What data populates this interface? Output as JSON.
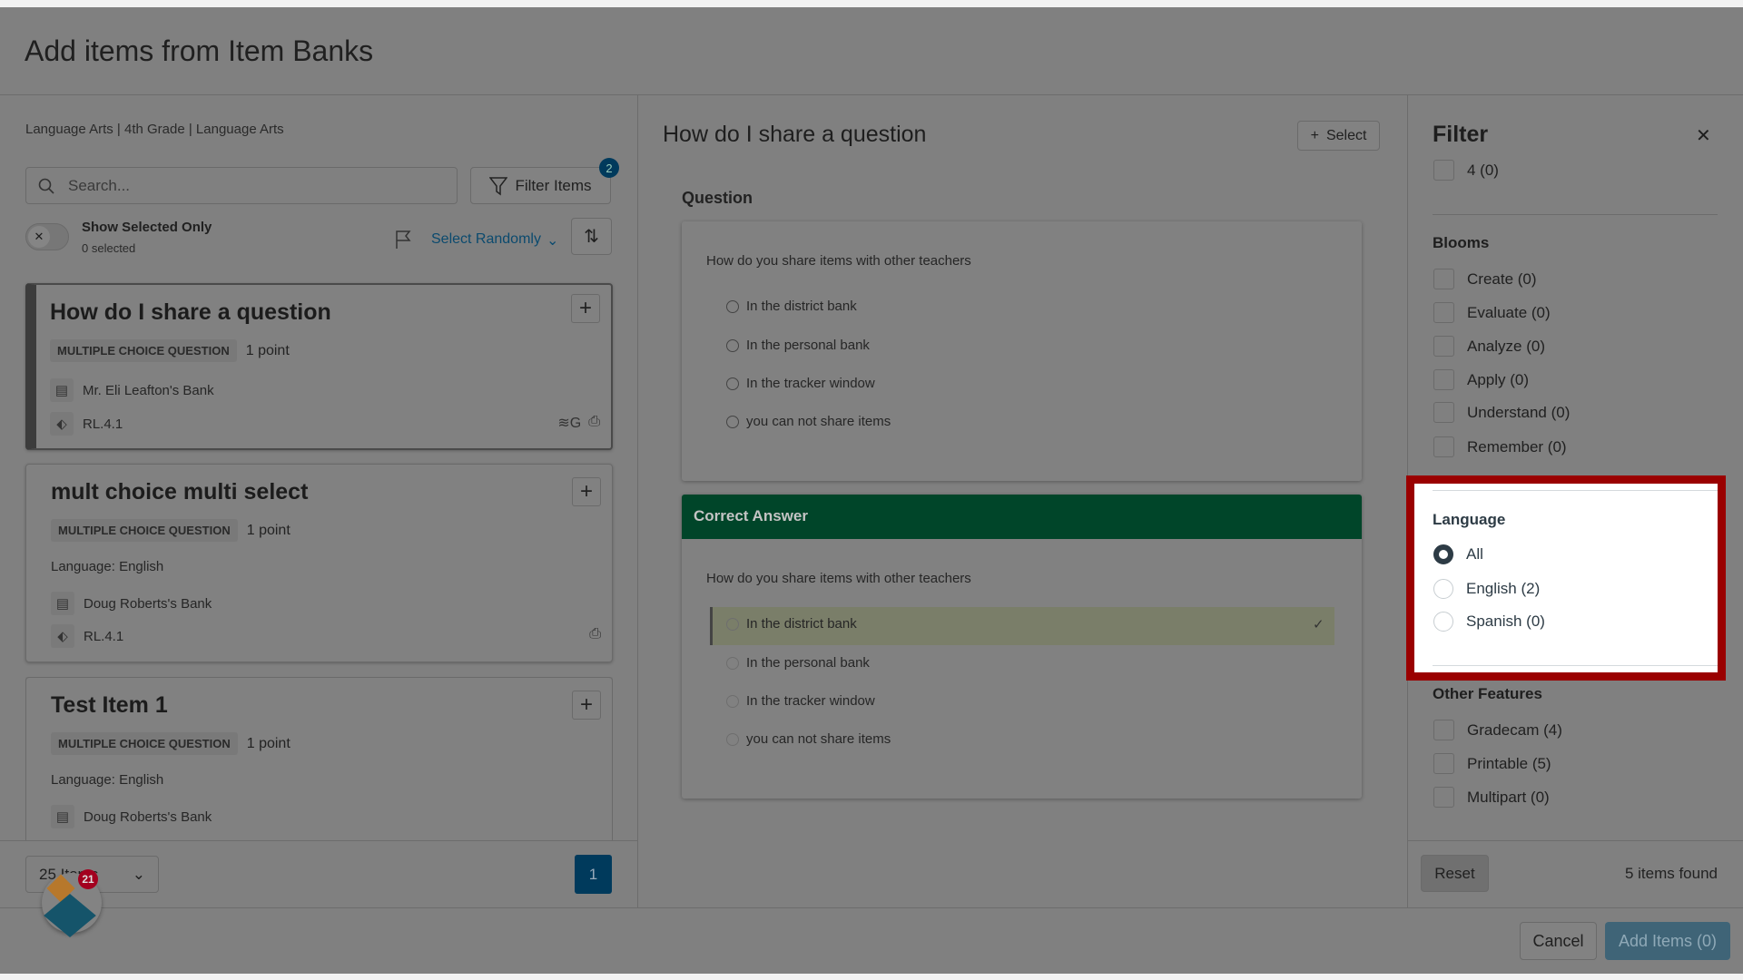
{
  "modal": {
    "title": "Add items from Item Banks"
  },
  "left": {
    "breadcrumb": "Language Arts | 4th Grade | Language Arts",
    "search_placeholder": "Search...",
    "filter_button": "Filter Items",
    "filter_badge": "2",
    "toggle_icon": "x-icon",
    "show_selected_label": "Show Selected Only",
    "selected_count": "0 selected",
    "select_randomly": "Select Randomly",
    "items": [
      {
        "title": "How do I share a question",
        "type": "MULTIPLE CHOICE QUESTION",
        "points": "1 point",
        "bank": "Mr. Eli Leafton's Bank",
        "standard": "RL.4.1",
        "selected": true
      },
      {
        "title": "mult choice multi select",
        "type": "MULTIPLE CHOICE QUESTION",
        "points": "1 point",
        "language": "Language: English",
        "bank": "Doug Roberts's Bank",
        "standard": "RL.4.1"
      },
      {
        "title": "Test Item 1",
        "type": "MULTIPLE CHOICE QUESTION",
        "points": "1 point",
        "language": "Language: English",
        "bank": "Doug Roberts's Bank"
      }
    ],
    "per_page": "25 Items",
    "page": "1",
    "app_badge": "21"
  },
  "preview": {
    "title": "How do I share a question",
    "select_button": "Select",
    "question_label": "Question",
    "question_text": "How do you share items with other teachers",
    "options": [
      "In the district bank",
      "In the personal bank",
      "In the tracker window",
      "you can not share items"
    ],
    "correct_header": "Correct Answer",
    "correct_index": 0
  },
  "filter": {
    "title": "Filter",
    "partial_item": "4 (0)",
    "blooms_title": "Blooms",
    "blooms": [
      "Create (0)",
      "Evaluate (0)",
      "Analyze (0)",
      "Apply (0)",
      "Understand (0)",
      "Remember (0)"
    ],
    "language_title": "Language",
    "languages": [
      "All",
      "English (2)",
      "Spanish (0)"
    ],
    "language_selected": "All",
    "other_title": "Other Features",
    "other": [
      "Gradecam (4)",
      "Printable (5)",
      "Multipart (0)"
    ],
    "reset": "Reset",
    "found": "5 items found"
  },
  "footer": {
    "cancel": "Cancel",
    "add": "Add Items (0)"
  },
  "colors": {
    "highlight": "#9a0000",
    "correct_header": "#004529",
    "accent": "#003a5c"
  }
}
